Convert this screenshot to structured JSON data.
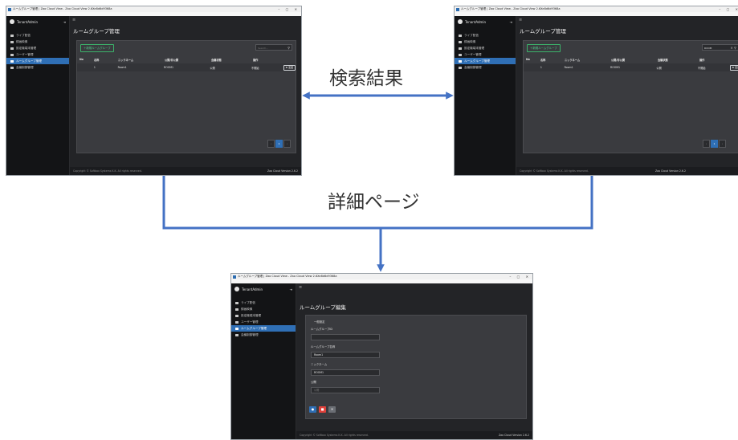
{
  "app": {
    "window_title": "ルームグループ管理 | Zao Cloud View - Zao Cloud View 2.6Xe8d6d9368a",
    "menu": [
      "View",
      "Player",
      "Help",
      "DevTools"
    ],
    "window_controls": "– ▢ ✕",
    "user_name": "TenantAdmin",
    "logout_icon": "logout-icon",
    "hamburger": "≡"
  },
  "sidebar": {
    "items": [
      {
        "label": "ライブ配信",
        "icon": "camera-icon"
      },
      {
        "label": "録画映像",
        "icon": "film-icon"
      },
      {
        "label": "設定機端末管理",
        "icon": "device-icon"
      },
      {
        "label": "ユーザー管理",
        "icon": "user-icon"
      },
      {
        "label": "ルームグループ管理",
        "icon": "group-icon",
        "active": true
      },
      {
        "label": "会議制御管理",
        "icon": "meeting-icon"
      }
    ]
  },
  "list_page": {
    "title": "ルームグループ管理",
    "add_button": "＋新規ルームグループ",
    "search_placeholder": "Search...",
    "search_value_result": "ROOM",
    "columns": [
      "No",
      "名称",
      "ニックネーム",
      "公開/非公開",
      "会議状態",
      "操作"
    ],
    "rows": [
      {
        "no": "1",
        "name": "Room1",
        "nickname": "ROOM1",
        "visibility": "公開",
        "status": "不開始",
        "action": "変更"
      }
    ],
    "pager": [
      "‹",
      "1",
      "›"
    ]
  },
  "detail_page": {
    "title": "ルームグループ編集",
    "section": "一般設定",
    "fields": [
      {
        "label": "ルームグループID",
        "value": ""
      },
      {
        "label": "ルームグループ名称",
        "value": "Room1"
      },
      {
        "label": "ニックネーム",
        "value": "ROOM1"
      },
      {
        "label": "公開",
        "value": "公開"
      }
    ],
    "buttons": [
      "save",
      "delete",
      "back"
    ]
  },
  "footer": {
    "copyright": "Copyright © Softbox Systems K.K. All rights reserved.",
    "version": "Zao Cloud Version 2.6.2"
  },
  "annotations": {
    "search_result": "検索結果",
    "detail_page": "詳細ページ"
  },
  "colors": {
    "arrow": "#4472c4",
    "accent": "#2f6fb5",
    "add_green": "#3bb36a",
    "delete_red": "#e0413b"
  }
}
